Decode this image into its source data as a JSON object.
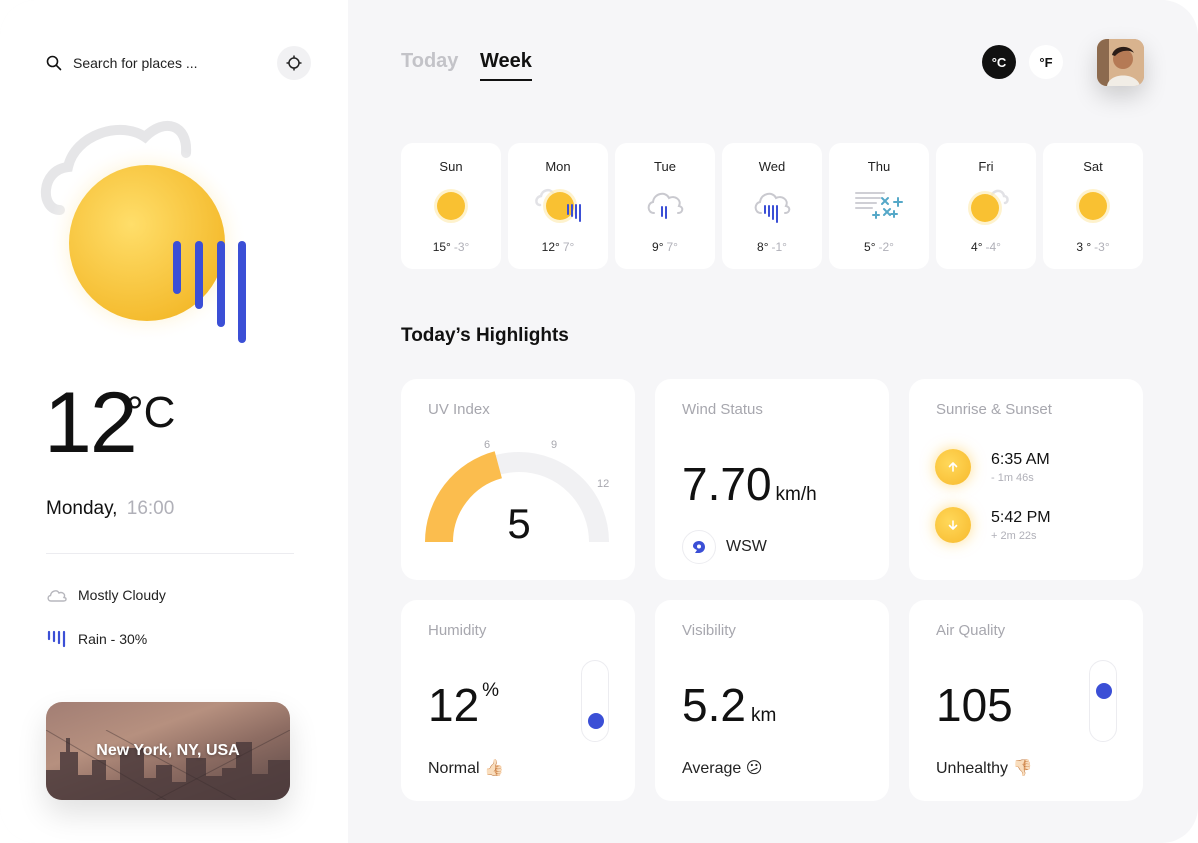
{
  "search": {
    "placeholder": "Search for places ..."
  },
  "current": {
    "temperature": "12",
    "unit": "°C",
    "day": "Monday,",
    "time": "16:00",
    "conditions": [
      {
        "icon": "cloud-icon",
        "label": "Mostly Cloudy"
      },
      {
        "icon": "rain-icon",
        "label": "Rain - 30%"
      }
    ],
    "city": "New York, NY, USA"
  },
  "tabs": {
    "today": "Today",
    "week": "Week",
    "active": "Week"
  },
  "units": {
    "celsius": "°C",
    "fahrenheit": "°F",
    "selected": "°C"
  },
  "week": [
    {
      "day": "Sun",
      "icon": "sun-icon",
      "high": "15°",
      "low": "-3°"
    },
    {
      "day": "Mon",
      "icon": "sun-cloud-rain-icon",
      "high": "12°",
      "low": "7°"
    },
    {
      "day": "Tue",
      "icon": "cloud-rain-icon",
      "high": "9°",
      "low": "7°"
    },
    {
      "day": "Wed",
      "icon": "cloud-heavy-rain-icon",
      "high": "8°",
      "low": "-1°"
    },
    {
      "day": "Thu",
      "icon": "wind-snow-icon",
      "high": "5°",
      "low": "-2°"
    },
    {
      "day": "Fri",
      "icon": "sun-cloud-icon",
      "high": "4°",
      "low": "-4°"
    },
    {
      "day": "Sat",
      "icon": "sun-icon",
      "high": "3 °",
      "low": "-3°"
    }
  ],
  "highlights": {
    "title": "Today’s Highlights",
    "uv": {
      "title": "UV Index",
      "value": "5",
      "max": 12,
      "ticks": [
        "6",
        "9",
        "12"
      ]
    },
    "wind": {
      "title": "Wind Status",
      "value": "7.70",
      "unit": "km/h",
      "direction": "WSW"
    },
    "sun": {
      "title": "Sunrise & Sunset",
      "sunrise": {
        "time": "6:35 AM",
        "diff": "- 1m 46s"
      },
      "sunset": {
        "time": "5:42 PM",
        "diff": "+ 2m 22s"
      }
    },
    "humidity": {
      "title": "Humidity",
      "value": "12",
      "unit": "%",
      "note": "Normal 👍🏻",
      "level": 0.12
    },
    "visibility": {
      "title": "Visibility",
      "value": "5.2",
      "unit": "km",
      "note": "Average 😕"
    },
    "air": {
      "title": "Air Quality",
      "value": "105",
      "note": "Unhealthy 👎🏻",
      "level": 0.7
    }
  },
  "colors": {
    "accent": "#3b4fd6",
    "sun": "#f9c132",
    "uv": "#fbbd4e",
    "background": "#f6f6f8"
  }
}
